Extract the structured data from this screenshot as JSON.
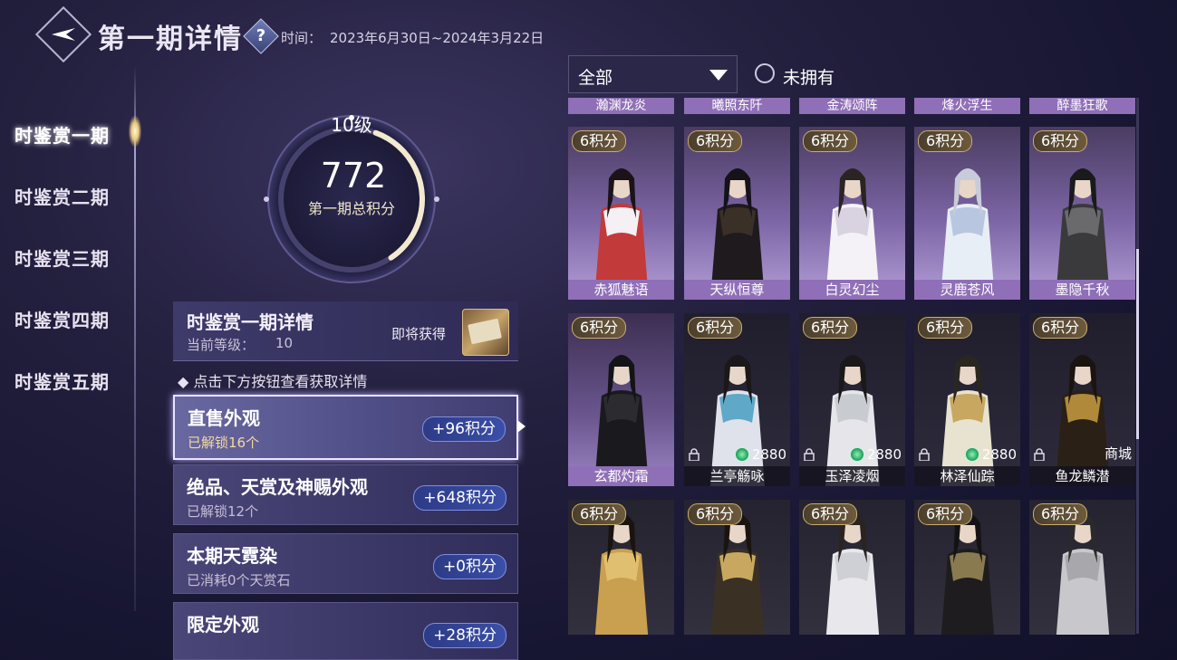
{
  "header": {
    "title": "第一期详情",
    "help_icon": "question-icon",
    "period_label": "时间：",
    "period_value": "2023年6月30日~2024年3月22日"
  },
  "nav": {
    "items": [
      {
        "label": "时鉴赏一期"
      },
      {
        "label": "时鉴赏二期"
      },
      {
        "label": "时鉴赏三期"
      },
      {
        "label": "时鉴赏四期"
      },
      {
        "label": "时鉴赏五期"
      }
    ]
  },
  "summary": {
    "level": "10级",
    "score": "772",
    "score_label": "第一期总积分",
    "progress_fraction": 0.35
  },
  "detail": {
    "title": "时鉴赏一期详情",
    "level_label": "当前等级：",
    "level_value": "10",
    "soon_label": "即将获得"
  },
  "hint": "◆ 点击下方按钮查看获取详情",
  "categories": [
    {
      "title": "直售外观",
      "sub": "已解锁16个",
      "badge": "+96积分"
    },
    {
      "title": "绝品、天赏及神赐外观",
      "sub": "已解锁12个",
      "badge": "+648积分"
    },
    {
      "title": "本期天霓染",
      "sub": "已消耗0个天赏石",
      "badge": "+0积分"
    },
    {
      "title": "限定外观",
      "sub": "",
      "badge": "+28积分"
    }
  ],
  "filter": {
    "selected": "全部",
    "checkbox_label": "未拥有"
  },
  "grid": {
    "top_strip": [
      "瀚渊龙炎",
      "曦照东阡",
      "金涛颂阵",
      "烽火浮生",
      "醉墨狂歌"
    ],
    "row1": [
      {
        "tag": "6积分",
        "name": "赤狐魅语"
      },
      {
        "tag": "6积分",
        "name": "天纵恒尊"
      },
      {
        "tag": "6积分",
        "name": "白灵幻尘"
      },
      {
        "tag": "6积分",
        "name": "灵鹿苍风"
      },
      {
        "tag": "6积分",
        "name": "墨隐千秋"
      }
    ],
    "row2": [
      {
        "tag": "6积分",
        "name": "玄都灼霜",
        "price": ""
      },
      {
        "tag": "6积分",
        "name": "兰亭觞咏",
        "price": "2880"
      },
      {
        "tag": "6积分",
        "name": "玉泽凌烟",
        "price": "2880"
      },
      {
        "tag": "6积分",
        "name": "林泽仙踪",
        "price": "2880"
      },
      {
        "tag": "6积分",
        "name": "鱼龙鳞潜",
        "price": "商城"
      }
    ],
    "row3": [
      {
        "tag": "6积分"
      },
      {
        "tag": "6积分"
      },
      {
        "tag": "6积分"
      },
      {
        "tag": "6积分"
      },
      {
        "tag": "6积分"
      }
    ]
  },
  "colors": {
    "accent": "#8f6fb7",
    "badge": "#3b4fa8",
    "gold": "#c8ad73"
  }
}
